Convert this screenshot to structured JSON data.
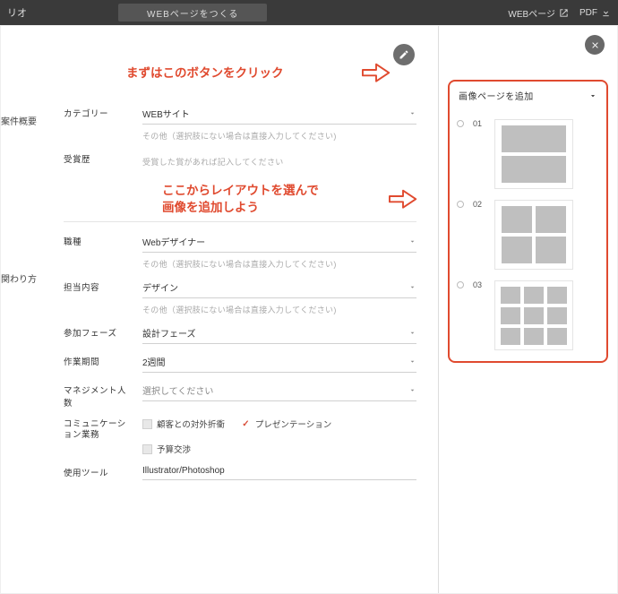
{
  "header": {
    "title_fragment": "リオ",
    "create_button": "WEBページをつくる",
    "web_link": "WEBページ",
    "pdf_link": "PDF"
  },
  "callouts": {
    "click_button": "まずはこのボタンをクリック",
    "choose_layout_l1": "ここからレイアウトを選んで",
    "choose_layout_l2": "画像を追加しよう"
  },
  "sections": {
    "overview": "案件概要",
    "involvement": "関わり方"
  },
  "form": {
    "category": {
      "label": "カテゴリー",
      "value": "WEBサイト",
      "hint": "その他（選択肢にない場合は直接入力してください)"
    },
    "award": {
      "label": "受賞歴",
      "hint": "受賞した賞があれば記入してください"
    },
    "role": {
      "label": "職種",
      "value": "Webデザイナー",
      "hint": "その他（選択肢にない場合は直接入力してください)"
    },
    "work": {
      "label": "担当内容",
      "value": "デザイン",
      "hint": "その他（選択肢にない場合は直接入力してください)"
    },
    "phase": {
      "label": "参加フェーズ",
      "value": "設計フェーズ"
    },
    "duration": {
      "label": "作業期間",
      "value": "2週間"
    },
    "management": {
      "label": "マネジメント人数",
      "placeholder": "選択してください"
    },
    "comm": {
      "label": "コミュニケーション業務",
      "opt1": "顧客との対外折衝",
      "opt2": "プレゼンテーション",
      "opt3": "予算交渉"
    },
    "tools": {
      "label": "使用ツール",
      "value": "Illustrator/Photoshop"
    }
  },
  "layout_picker": {
    "heading": "画像ページを追加",
    "opt1": "01",
    "opt2": "02",
    "opt3": "03"
  }
}
